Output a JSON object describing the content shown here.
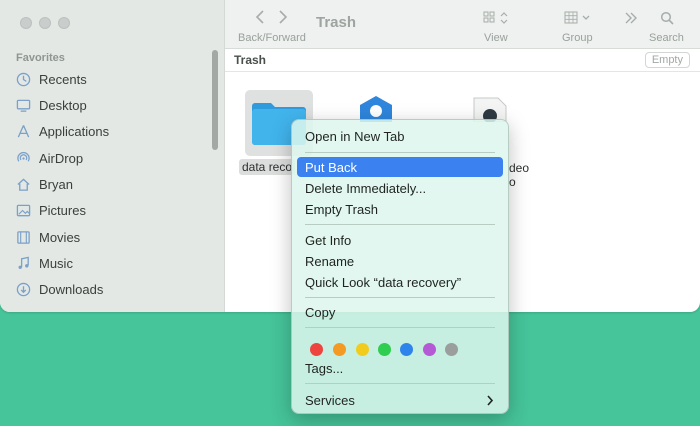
{
  "toolbar": {
    "title": "Trash",
    "back_forward_label": "Back/Forward",
    "view_label": "View",
    "group_label": "Group",
    "search_label": "Search"
  },
  "sidebar": {
    "heading": "Favorites",
    "items": [
      {
        "label": "Recents",
        "icon": "clock-icon"
      },
      {
        "label": "Desktop",
        "icon": "desktop-icon"
      },
      {
        "label": "Applications",
        "icon": "applications-icon"
      },
      {
        "label": "AirDrop",
        "icon": "airdrop-icon"
      },
      {
        "label": "Bryan",
        "icon": "home-icon"
      },
      {
        "label": "Pictures",
        "icon": "pictures-icon"
      },
      {
        "label": "Movies",
        "icon": "movies-icon"
      },
      {
        "label": "Music",
        "icon": "music-icon"
      },
      {
        "label": "Downloads",
        "icon": "downloads-icon"
      }
    ]
  },
  "pathbar": {
    "title": "Trash",
    "empty_button": "Empty"
  },
  "files": [
    {
      "label": "data  reco",
      "icon": "folder-icon"
    },
    {
      "label": "",
      "icon": "app-icon"
    },
    {
      "label": "deo",
      "label_line2": "o",
      "icon": "video-file-icon"
    }
  ],
  "context_menu": {
    "open_new_tab": "Open in New Tab",
    "put_back": "Put Back",
    "delete_immediately": "Delete Immediately...",
    "empty_trash": "Empty Trash",
    "get_info": "Get Info",
    "rename": "Rename",
    "quick_look": "Quick Look “data  recovery”",
    "copy": "Copy",
    "tags_label": "Tags...",
    "services": "Services",
    "selected_item": "Put Back",
    "tag_colors": [
      "#ee4440",
      "#f39a24",
      "#f2cc1c",
      "#2fcd50",
      "#2f84ec",
      "#b45ad4",
      "#9a9e9c"
    ]
  },
  "colors": {
    "background": "#46c49a",
    "selection": "#3b82f0",
    "folder": "#3fb0ea"
  }
}
